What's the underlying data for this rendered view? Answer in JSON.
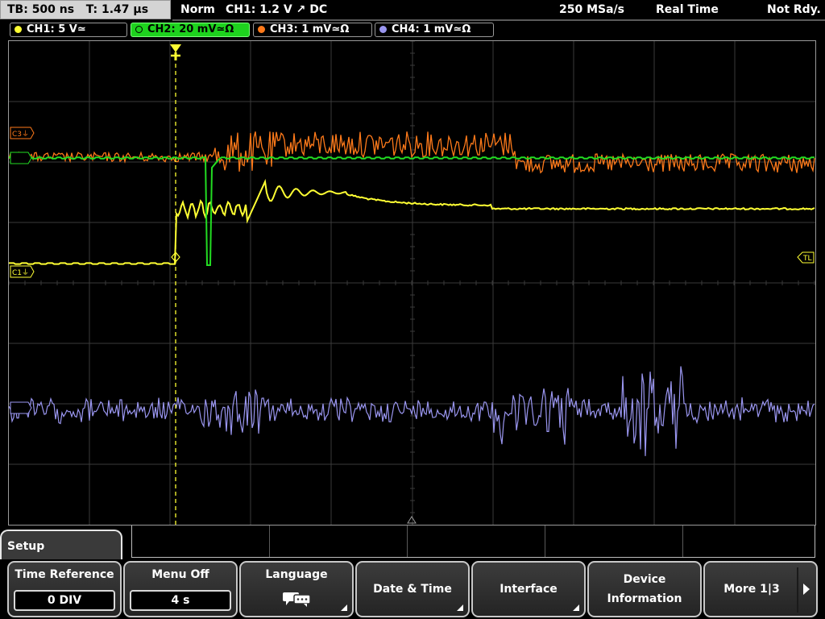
{
  "status": {
    "timebase": "TB: 500 ns",
    "trigger_time": "T: 1.47 µs",
    "mode": "Norm",
    "trigger_info": "CH1: 1.2 V ↗ DC",
    "sample_rate": "250 MSa/s",
    "acq_mode": "Real Time",
    "state": "Not Rdy."
  },
  "channels": [
    {
      "label": "CH1: 5 V≃",
      "color": "#ffff33",
      "active": false
    },
    {
      "label": "CH2: 20 mV≃Ω",
      "color": "#22dd22",
      "active": true
    },
    {
      "label": "CH3: 1 mV≃Ω",
      "color": "#ff7a1a",
      "active": false
    },
    {
      "label": "CH4: 1 mV≃Ω",
      "color": "#9a96f0",
      "active": false
    }
  ],
  "screen": {
    "markers": {
      "c3": "C3⏚",
      "c1": "C1⏚",
      "trigger_level": "TL",
      "trigger_pos": "T"
    }
  },
  "menu": {
    "title": "Setup",
    "buttons": [
      {
        "label": "Time Reference",
        "value": "0 DIV"
      },
      {
        "label": "Menu Off",
        "value": "4 s"
      },
      {
        "label": "Language",
        "icon": "speech-bubbles-icon"
      },
      {
        "label": "Date & Time"
      },
      {
        "label": "Interface"
      },
      {
        "label_line1": "Device",
        "label_line2": "Information"
      },
      {
        "label": "More 1|3"
      }
    ]
  },
  "colors": {
    "ch1": "#ffff33",
    "ch2": "#22dd22",
    "ch3": "#ff7a1a",
    "ch4": "#9a96f0",
    "grid": "#3a3a3a",
    "tab_active": "#1ed21e"
  }
}
